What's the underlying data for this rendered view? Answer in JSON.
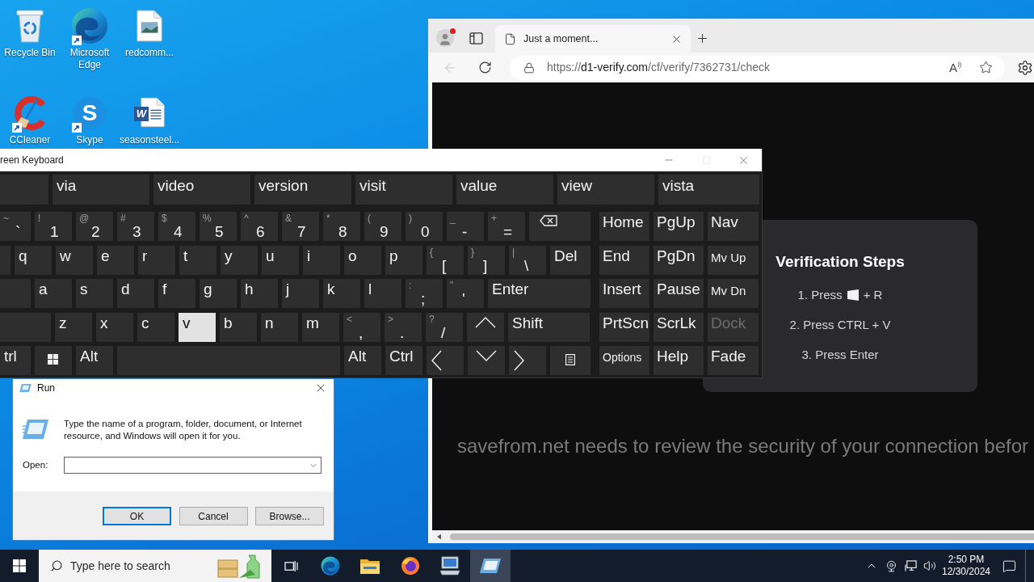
{
  "desktop": {
    "icons": [
      {
        "kind": "recycle",
        "label": "Recycle Bin",
        "shortcut": false
      },
      {
        "kind": "edge",
        "label": "Microsoft Edge",
        "shortcut": true
      },
      {
        "kind": "image",
        "label": "redcomm...",
        "shortcut": false
      },
      {
        "kind": "ccleaner",
        "label": "CCleaner",
        "shortcut": true
      },
      {
        "kind": "skype",
        "label": "Skype",
        "shortcut": true,
        "glyph": "S"
      },
      {
        "kind": "word",
        "label": "seasonsteel...",
        "shortcut": false,
        "glyph": "W"
      }
    ]
  },
  "browser": {
    "profile": {
      "notification": true
    },
    "tabs": [
      {
        "title": "Just a moment...",
        "selected": true
      }
    ],
    "back": {
      "disabled": true
    },
    "address": {
      "scheme": "https://",
      "domain": "d1-verify.com",
      "path": "/cf/verify/7362731/check"
    },
    "read_aloud_glyph": "A",
    "page": {
      "card": {
        "title": "Verification Steps",
        "steps": [
          {
            "kind": "combo",
            "before": "1. Press",
            "after": "+ R"
          },
          {
            "kind": "plain",
            "text": "2. Press CTRL + V"
          },
          {
            "kind": "plain",
            "text": "3. Press Enter"
          }
        ]
      },
      "message": "savefrom.net needs to review the security of your connection befor"
    }
  },
  "keyboard": {
    "title": "reen Keyboard",
    "maximize": {
      "disabled": true
    },
    "suggestions": [
      {
        "kind": "blank"
      },
      {
        "kind": "word",
        "text": "via"
      },
      {
        "kind": "word",
        "text": "video"
      },
      {
        "kind": "word",
        "text": "version"
      },
      {
        "kind": "word",
        "text": "visit"
      },
      {
        "kind": "word",
        "text": "value"
      },
      {
        "kind": "word",
        "text": "view"
      },
      {
        "kind": "word",
        "text": "vista"
      }
    ],
    "rows": [
      [
        {
          "kind": "dual",
          "shift": "~",
          "label": "`",
          "pressed": false
        },
        {
          "kind": "dual",
          "shift": "!",
          "label": "1",
          "pressed": false
        },
        {
          "kind": "dual",
          "shift": "@",
          "label": "2",
          "pressed": false
        },
        {
          "kind": "dual",
          "shift": "#",
          "label": "3",
          "pressed": false
        },
        {
          "kind": "dual",
          "shift": "$",
          "label": "4",
          "pressed": false
        },
        {
          "kind": "dual",
          "shift": "%",
          "label": "5",
          "pressed": false
        },
        {
          "kind": "dual",
          "shift": "^",
          "label": "6",
          "pressed": false
        },
        {
          "kind": "dual",
          "shift": "&",
          "label": "7",
          "pressed": false
        },
        {
          "kind": "dual",
          "shift": "*",
          "label": "8",
          "pressed": false
        },
        {
          "kind": "dual",
          "shift": "(",
          "label": "9",
          "pressed": false
        },
        {
          "kind": "dual",
          "shift": ")",
          "label": "0",
          "pressed": false
        },
        {
          "kind": "dual",
          "shift": "_",
          "label": "-",
          "pressed": false
        },
        {
          "kind": "dual",
          "shift": "+",
          "label": "=",
          "pressed": false
        },
        {
          "kind": "backspace",
          "pressed": false
        }
      ],
      [
        {
          "kind": "blank",
          "pressed": false
        },
        {
          "kind": "text",
          "label": "q",
          "pressed": false
        },
        {
          "kind": "text",
          "label": "w",
          "pressed": false
        },
        {
          "kind": "text",
          "label": "e",
          "pressed": false
        },
        {
          "kind": "text",
          "label": "r",
          "pressed": false
        },
        {
          "kind": "text",
          "label": "t",
          "pressed": false
        },
        {
          "kind": "text",
          "label": "y",
          "pressed": false
        },
        {
          "kind": "text",
          "label": "u",
          "pressed": false
        },
        {
          "kind": "text",
          "label": "i",
          "pressed": false
        },
        {
          "kind": "text",
          "label": "o",
          "pressed": false
        },
        {
          "kind": "text",
          "label": "p",
          "pressed": false
        },
        {
          "kind": "dual",
          "shift": "{",
          "label": "[",
          "pressed": false
        },
        {
          "kind": "dual",
          "shift": "}",
          "label": "]",
          "pressed": false
        },
        {
          "kind": "dual",
          "shift": "|",
          "label": "\\",
          "pressed": false
        },
        {
          "kind": "text",
          "label": "Del",
          "pressed": false
        }
      ],
      [
        {
          "kind": "blank",
          "pressed": false
        },
        {
          "kind": "text",
          "label": "a",
          "pressed": false
        },
        {
          "kind": "text",
          "label": "s",
          "pressed": false
        },
        {
          "kind": "text",
          "label": "d",
          "pressed": false
        },
        {
          "kind": "text",
          "label": "f",
          "pressed": false
        },
        {
          "kind": "text",
          "label": "g",
          "pressed": false
        },
        {
          "kind": "text",
          "label": "h",
          "pressed": false
        },
        {
          "kind": "text",
          "label": "j",
          "pressed": false
        },
        {
          "kind": "text",
          "label": "k",
          "pressed": false
        },
        {
          "kind": "text",
          "label": "l",
          "pressed": false
        },
        {
          "kind": "dual",
          "shift": ":",
          "label": ";",
          "pressed": false
        },
        {
          "kind": "dual",
          "shift": "\"",
          "label": "'",
          "pressed": false
        },
        {
          "kind": "text",
          "label": "Enter",
          "pressed": false
        }
      ],
      [
        {
          "kind": "blank",
          "pressed": false
        },
        {
          "kind": "text",
          "label": "z",
          "pressed": false
        },
        {
          "kind": "text",
          "label": "x",
          "pressed": false
        },
        {
          "kind": "text",
          "label": "c",
          "pressed": false
        },
        {
          "kind": "text",
          "label": "v",
          "pressed": true
        },
        {
          "kind": "text",
          "label": "b",
          "pressed": false
        },
        {
          "kind": "text",
          "label": "n",
          "pressed": false
        },
        {
          "kind": "text",
          "label": "m",
          "pressed": false
        },
        {
          "kind": "dual",
          "shift": "<",
          "label": ",",
          "pressed": false
        },
        {
          "kind": "dual",
          "shift": ">",
          "label": ".",
          "pressed": false
        },
        {
          "kind": "dual",
          "shift": "?",
          "label": "/",
          "pressed": false
        },
        {
          "kind": "up",
          "pressed": false
        },
        {
          "kind": "text",
          "label": "Shift",
          "pressed": false
        }
      ],
      [
        {
          "kind": "text",
          "label": "trl",
          "pressed": false
        },
        {
          "kind": "windows",
          "pressed": false
        },
        {
          "kind": "text",
          "label": "Alt",
          "pressed": false
        },
        {
          "kind": "blank",
          "pressed": false
        },
        {
          "kind": "text",
          "label": "Alt",
          "pressed": false
        },
        {
          "kind": "text",
          "label": "Ctrl",
          "pressed": false
        },
        {
          "kind": "left",
          "pressed": false
        },
        {
          "kind": "down",
          "pressed": false
        },
        {
          "kind": "right",
          "pressed": false
        },
        {
          "kind": "menu",
          "pressed": false
        }
      ]
    ],
    "nav_keys": [
      {
        "label": "Home",
        "disabled": false
      },
      {
        "label": "PgUp",
        "disabled": false
      },
      {
        "label": "Nav",
        "disabled": false
      },
      {
        "label": "End",
        "disabled": false
      },
      {
        "label": "PgDn",
        "disabled": false
      },
      {
        "label": "Mv Up",
        "disabled": false
      },
      {
        "label": "Insert",
        "disabled": false
      },
      {
        "label": "Pause",
        "disabled": false
      },
      {
        "label": "Mv Dn",
        "disabled": false
      },
      {
        "label": "PrtScn",
        "disabled": false
      },
      {
        "label": "ScrLk",
        "disabled": false
      },
      {
        "label": "Dock",
        "disabled": true
      },
      {
        "label": "Options",
        "disabled": false
      },
      {
        "label": "Help",
        "disabled": false
      },
      {
        "label": "Fade",
        "disabled": false
      }
    ]
  },
  "run_dialog": {
    "title": "Run",
    "message": "Type the name of a program, folder, document, or Internet resource, and Windows will open it for you.",
    "open_label": "Open:",
    "field": {
      "focused": true
    },
    "buttons": [
      {
        "label": "OK",
        "default": true
      },
      {
        "label": "Cancel",
        "default": false
      },
      {
        "label": "Browse...",
        "default": false
      }
    ]
  },
  "taskbar": {
    "search": {
      "placeholder": "Type here to search"
    },
    "apps": [
      {
        "kind": "taskview",
        "active": false
      },
      {
        "kind": "edge",
        "active": false
      },
      {
        "kind": "folder",
        "active": false
      },
      {
        "kind": "firefox",
        "active": false
      },
      {
        "kind": "osk",
        "active": false
      },
      {
        "kind": "run",
        "active": true
      }
    ],
    "clock": {
      "time": "2:50 PM",
      "date": "12/30/2024"
    }
  }
}
